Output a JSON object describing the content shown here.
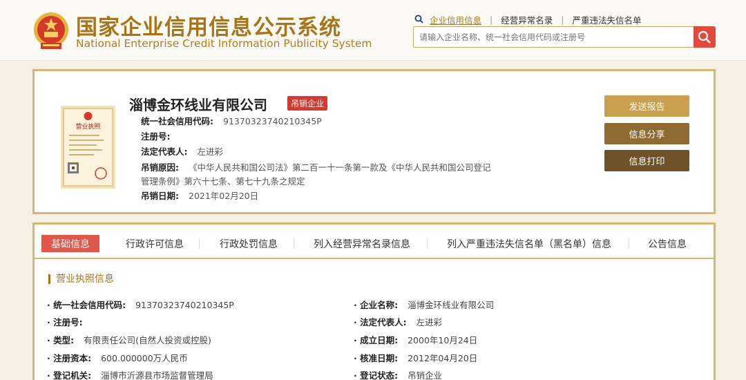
{
  "header": {
    "title_cn": "国家企业信用信息公示系统",
    "title_en": "National Enterprise Credit Information Publicity System",
    "links": [
      "企业信用信息",
      "经营异常名录",
      "严重违法失信名单"
    ],
    "search_placeholder": "请输入企业名称、统一社会信用代码或注册号",
    "colors": {
      "brand": "#a8741a",
      "search_button": "#e04a3c"
    }
  },
  "company": {
    "name": "淄博金环线业有限公司",
    "status_tag": "吊销企业",
    "fields": [
      {
        "label": "统一社会信用代码:",
        "value": "91370323740210345P"
      },
      {
        "label": "注册号:",
        "value": ""
      },
      {
        "label": "法定代表人:",
        "value": "左进彩"
      },
      {
        "label": "吊销原因:",
        "value": "《中华人民共和国公司法》第二百一十一条第一款及《中华人民共和国公司登记",
        "value_line2": "管理条例》第六十七条、第七十九条之规定"
      },
      {
        "label": "吊销日期:",
        "value": "2021年02月20日"
      }
    ],
    "buttons": [
      "发送报告",
      "信息分享",
      "信息打印"
    ],
    "license_image_text": "营业执照"
  },
  "tabs": [
    {
      "label": "基础信息",
      "active": true
    },
    {
      "label": "行政许可信息",
      "active": false
    },
    {
      "label": "行政处罚信息",
      "active": false
    },
    {
      "label": "列入经营异常名录信息",
      "active": false
    },
    {
      "label": "列入严重违法失信名单（黑名单）信息",
      "active": false
    },
    {
      "label": "公告信息",
      "active": false
    }
  ],
  "license_info": {
    "title": "营业执照信息",
    "left": [
      {
        "label": "· 统一社会信用代码:",
        "value": "91370323740210345P"
      },
      {
        "label": "· 注册号:",
        "value": ""
      },
      {
        "label": "· 类型:",
        "value": "有限责任公司(自然人投资或控股)"
      },
      {
        "label": "· 注册资本:",
        "value": "600.000000万人民币"
      },
      {
        "label": "· 登记机关:",
        "value": "淄博市沂源县市场监督管理局"
      }
    ],
    "right": [
      {
        "label": "· 企业名称:",
        "value": "淄博金环线业有限公司"
      },
      {
        "label": "· 法定代表人:",
        "value": "左进彩"
      },
      {
        "label": "· 成立日期:",
        "value": "2000年10月24日"
      },
      {
        "label": "· 核准日期:",
        "value": "2012年04月20日"
      },
      {
        "label": "· 登记状态:",
        "value": "吊销企业"
      }
    ]
  }
}
